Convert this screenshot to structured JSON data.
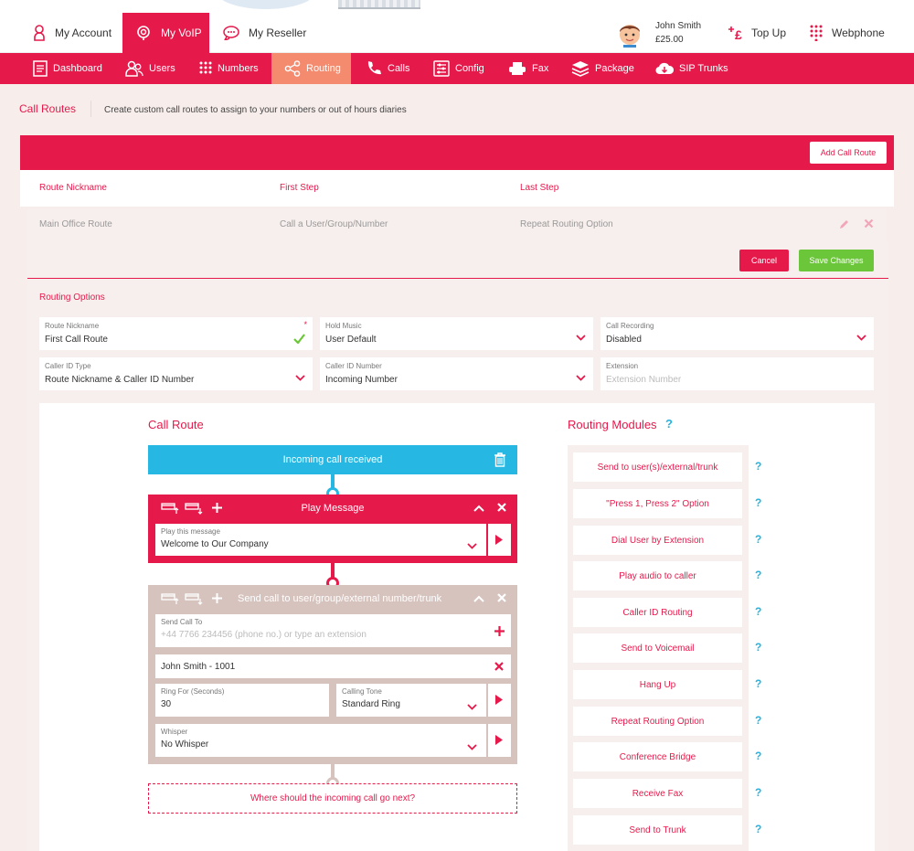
{
  "top_nav": {
    "my_account": "My Account",
    "my_voip": "My VoIP",
    "my_reseller": "My Reseller",
    "user_name": "John Smith",
    "user_balance": "£25.00",
    "top_up": "Top Up",
    "webphone": "Webphone"
  },
  "main_nav": {
    "items": [
      "Dashboard",
      "Users",
      "Numbers",
      "Routing",
      "Calls",
      "Config",
      "Fax",
      "Package",
      "SIP Trunks"
    ],
    "active": "Routing"
  },
  "page": {
    "title": "Call Routes",
    "description": "Create custom call routes to assign to your numbers or out of hours diaries",
    "add_button": "Add Call Route"
  },
  "table": {
    "headers": [
      "Route Nickname",
      "First Step",
      "Last Step"
    ],
    "row": [
      "Main Office Route",
      "Call a User/Group/Number",
      "Repeat Routing Option"
    ]
  },
  "editor": {
    "cancel": "Cancel",
    "save": "Save Changes",
    "section_title": "Routing Options",
    "fields": {
      "route_nickname_label": "Route Nickname",
      "route_nickname_value": "First Call Route",
      "required_mark": "*",
      "hold_music_label": "Hold Music",
      "hold_music_value": "User Default",
      "call_recording_label": "Call Recording",
      "call_recording_value": "Disabled",
      "caller_id_type_label": "Caller ID Type",
      "caller_id_type_value": "Route Nickname & Caller ID Number",
      "caller_id_number_label": "Caller ID Number",
      "caller_id_number_value": "Incoming Number",
      "extension_label": "Extension",
      "extension_placeholder": "Extension Number"
    }
  },
  "call_route": {
    "title": "Call Route",
    "incoming": "Incoming call received",
    "play_message": {
      "title": "Play Message",
      "label": "Play this message",
      "value": "Welcome to Our Company"
    },
    "send_call": {
      "title": "Send call to user/group/external number/trunk",
      "send_to_label": "Send Call To",
      "send_to_placeholder": "+44 7766 234456 (phone no.) or type an extension",
      "selected": "John Smith - 1001",
      "ring_for_label": "Ring For (Seconds)",
      "ring_for_value": "30",
      "calling_tone_label": "Calling Tone",
      "calling_tone_value": "Standard Ring",
      "whisper_label": "Whisper",
      "whisper_value": "No Whisper"
    },
    "next_prompt": "Where should the incoming call go next?"
  },
  "routing_modules": {
    "title": "Routing Modules",
    "help": "?",
    "items": [
      "Send to user(s)/external/trunk",
      "\"Press 1, Press 2\" Option",
      "Dial User by Extension",
      "Play audio to caller",
      "Caller ID Routing",
      "Send to Voicemail",
      "Hang Up",
      "Repeat Routing Option",
      "Conference Bridge",
      "Receive Fax",
      "Send to Trunk"
    ]
  },
  "colors": {
    "brand": "#e6194b",
    "active_tab": "#f48a6e",
    "incoming": "#26b8e3",
    "inactive_module": "#d6c3be",
    "save": "#6cc63a",
    "help": "#26b3e0"
  }
}
